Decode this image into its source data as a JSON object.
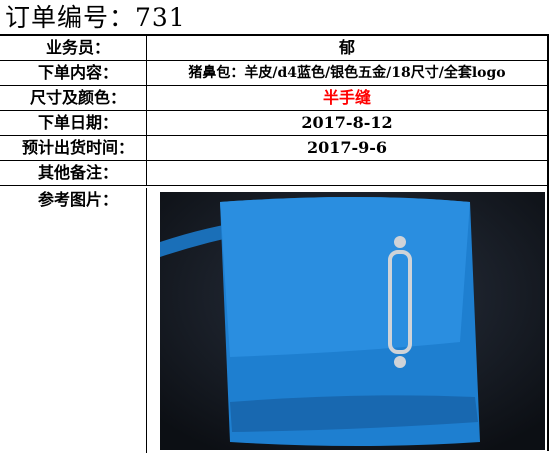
{
  "title": "订单编号：731",
  "rows": [
    {
      "label": "业务员：",
      "value": "郁"
    },
    {
      "label": "下单内容：",
      "value": "猪鼻包：羊皮/d4蓝色/银色五金/18尺寸/全套logo"
    },
    {
      "label": "尺寸及颜色：",
      "value": "半手缝"
    },
    {
      "label": "下单日期：",
      "value": "2017-8-12"
    },
    {
      "label": "预计出货时间：",
      "value": "2017-9-6"
    },
    {
      "label": "其他备注：",
      "value": ""
    },
    {
      "label": "参考图片：",
      "value": ""
    }
  ],
  "colors": {
    "highlight": "#ff0000",
    "bag": "#1e7fd0"
  }
}
